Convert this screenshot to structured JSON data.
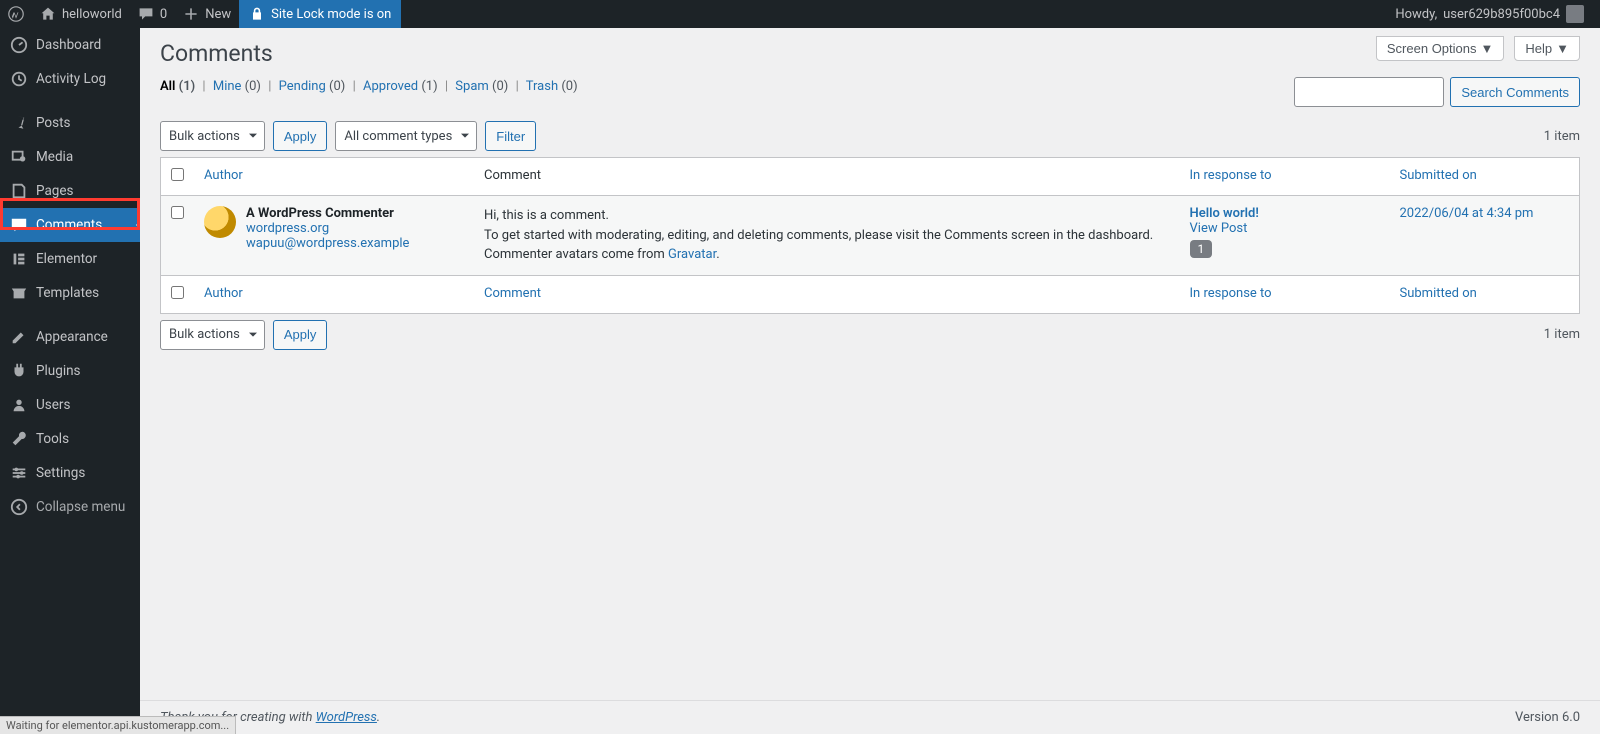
{
  "adminbar": {
    "site_name": "helloworld",
    "comments_count": "0",
    "new_label": "New",
    "lock_label": "Site Lock mode is on",
    "howdy_prefix": "Howdy, ",
    "user_name": "user629b895f00bc4"
  },
  "sidebar": {
    "items": [
      {
        "label": "Dashboard",
        "icon": "dashboard"
      },
      {
        "label": "Activity Log",
        "icon": "activity"
      },
      {
        "label": "Posts",
        "icon": "pin"
      },
      {
        "label": "Media",
        "icon": "media"
      },
      {
        "label": "Pages",
        "icon": "pages"
      },
      {
        "label": "Comments",
        "icon": "comments"
      },
      {
        "label": "Elementor",
        "icon": "elementor"
      },
      {
        "label": "Templates",
        "icon": "templates"
      },
      {
        "label": "Appearance",
        "icon": "appearance"
      },
      {
        "label": "Plugins",
        "icon": "plugins"
      },
      {
        "label": "Users",
        "icon": "users"
      },
      {
        "label": "Tools",
        "icon": "tools"
      },
      {
        "label": "Settings",
        "icon": "settings"
      },
      {
        "label": "Collapse menu",
        "icon": "collapse"
      }
    ]
  },
  "screen": {
    "screen_options": "Screen Options",
    "help": "Help"
  },
  "page": {
    "title": "Comments"
  },
  "filters": {
    "all_label": "All",
    "all_count": "(1)",
    "mine_label": "Mine",
    "mine_count": "(0)",
    "pending_label": "Pending",
    "pending_count": "(0)",
    "approved_label": "Approved",
    "approved_count": "(1)",
    "spam_label": "Spam",
    "spam_count": "(0)",
    "trash_label": "Trash",
    "trash_count": "(0)"
  },
  "search": {
    "button": "Search Comments"
  },
  "tablenav": {
    "bulk_actions": "Bulk actions",
    "apply": "Apply",
    "comment_types": "All comment types",
    "filter": "Filter",
    "count_text": "1 item"
  },
  "columns": {
    "author": "Author",
    "comment": "Comment",
    "response": "In response to",
    "date": "Submitted on"
  },
  "row": {
    "author_name": "A WordPress Commenter",
    "author_url": "wordpress.org",
    "author_email": "wapuu@wordpress.example",
    "comment_line1": "Hi, this is a comment.",
    "comment_line2a": "To get started with moderating, editing, and deleting comments, please visit ",
    "comment_line2b": "the Comments screen in the dashboard.",
    "comment_line3a": "Commenter avatars come from ",
    "gravatar": "Gravatar",
    "period": ".",
    "response_title": "Hello world!",
    "view_post": "View Post",
    "response_count": "1",
    "date": "2022/06/04 at 4:34 pm"
  },
  "footer": {
    "thanks_a": "Thank you for creating with ",
    "wp": "WordPress",
    "period": ".",
    "version": "Version 6.0"
  },
  "statusbar": {
    "text": "Waiting for elementor.api.kustomerapp.com..."
  }
}
